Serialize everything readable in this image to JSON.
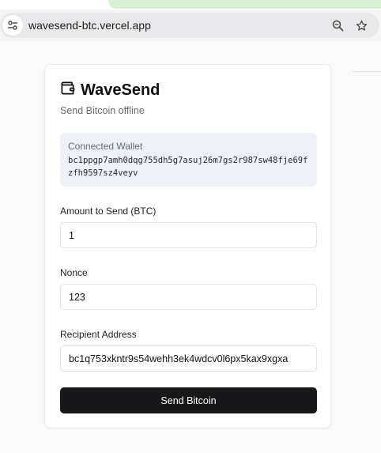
{
  "browser": {
    "url": "wavesend-btc.vercel.app",
    "icons": [
      "site-settings-icon",
      "zoom-icon",
      "star-icon"
    ]
  },
  "card": {
    "title": "WaveSend",
    "title_icon": "wallet-icon",
    "subtitle": "Send Bitcoin offline",
    "wallet": {
      "label": "Connected Wallet",
      "address": "bc1ppgp7amh0dqg755dh5g7asuj26m7gs2r987sw48fje69fzfh9597sz4veyv"
    },
    "amount": {
      "label": "Amount to Send (BTC)",
      "value": "1"
    },
    "nonce": {
      "label": "Nonce",
      "value": "123"
    },
    "recipient": {
      "label": "Recipient Address",
      "value": "bc1q753xkntr9s54wehh3ek4wdcv0l6px5kax9xgxa"
    },
    "send_label": "Send Bitcoin"
  },
  "colors": {
    "button_bg": "#18181b",
    "wallet_box_bg": "#eef2f7",
    "banner": "#d9f0d4"
  }
}
